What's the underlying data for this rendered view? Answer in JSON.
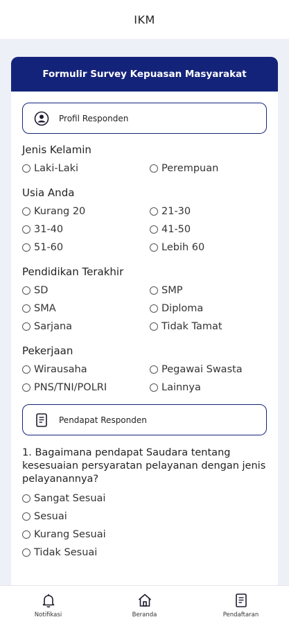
{
  "appbar": {
    "title": "IKM"
  },
  "card": {
    "title": "Formulir Survey Kepuasan Masyarakat"
  },
  "sections": {
    "profil": {
      "label": "Profil Responden",
      "icon": "user-circle-icon"
    },
    "pendapat": {
      "label": "Pendapat Responden",
      "icon": "document-icon"
    }
  },
  "questions": {
    "gender": {
      "label": "Jenis Kelamin",
      "options": [
        "Laki-Laki",
        "Perempuan"
      ]
    },
    "age": {
      "label": "Usia Anda",
      "options": [
        "Kurang 20",
        "21-30",
        "31-40",
        "41-50",
        "51-60",
        "Lebih 60"
      ]
    },
    "education": {
      "label": "Pendidikan Terakhir",
      "options": [
        "SD",
        "SMP",
        "SMA",
        "Diploma",
        "Sarjana",
        "Tidak Tamat"
      ]
    },
    "job": {
      "label": "Pekerjaan",
      "options": [
        "Wirausaha",
        "Pegawai Swasta",
        "PNS/TNI/POLRI",
        "Lainnya"
      ]
    },
    "q1": {
      "label": "1. Bagaimana pendapat Saudara tentang kesesuaian persyaratan pelayanan dengan jenis pelayanannya?",
      "options": [
        "Sangat Sesuai",
        "Sesuai",
        "Kurang Sesuai",
        "Tidak Sesuai"
      ]
    }
  },
  "nav": [
    {
      "label": "Notifikasi",
      "icon": "bell-icon"
    },
    {
      "label": "Beranda",
      "icon": "home-icon"
    },
    {
      "label": "Pendaftaran",
      "icon": "clipboard-icon"
    }
  ],
  "colors": {
    "primary": "#14237a",
    "background": "#eef0f8"
  }
}
